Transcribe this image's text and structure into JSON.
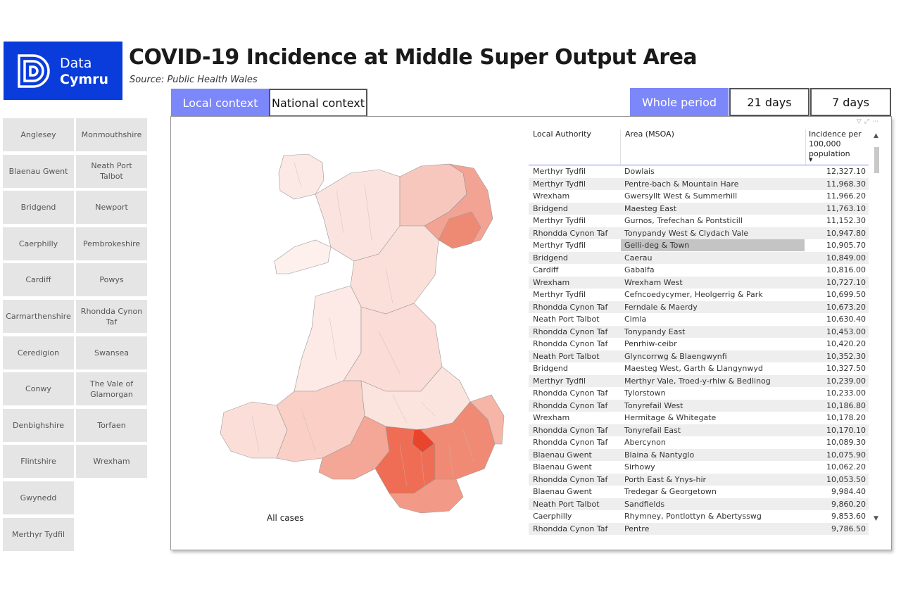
{
  "brand": {
    "line1": "Data",
    "line2": "Cymru",
    "color": "#0a3cdc"
  },
  "header": {
    "title": "COVID-19 Incidence at Middle Super Output Area",
    "source": "Source: Public Health Wales"
  },
  "context_tabs": [
    {
      "label": "Local context",
      "active": true
    },
    {
      "label": "National context",
      "active": false
    }
  ],
  "period_tabs": [
    {
      "label": "Whole period",
      "active": true
    },
    {
      "label": "21 days",
      "active": false
    },
    {
      "label": "7 days",
      "active": false
    }
  ],
  "accent_color": "#7c87f9",
  "authorities": [
    "Anglesey",
    "Monmouthshire",
    "Blaenau Gwent",
    "Neath Port Talbot",
    "Bridgend",
    "Newport",
    "Caerphilly",
    "Pembrokeshire",
    "Cardiff",
    "Powys",
    "Carmarthenshire",
    "Rhondda Cynon Taf",
    "Ceredigion",
    "Swansea",
    "Conwy",
    "The Vale of Glamorgan",
    "Denbighshire",
    "Torfaen",
    "Flintshire",
    "Wrexham",
    "Gwynedd",
    "Merthyr Tydfil"
  ],
  "map": {
    "caption": "All cases",
    "scale_low": "#fdf0ee",
    "scale_high": "#ef4a35"
  },
  "table": {
    "headers": {
      "authority": "Local Authority",
      "area": "Area (MSOA)",
      "incidence": "Incidence per 100,000 population"
    },
    "rows": [
      {
        "authority": "Merthyr Tydfil",
        "area": "Dowlais",
        "incidence": "12,327.10"
      },
      {
        "authority": "Merthyr Tydfil",
        "area": "Pentre-bach & Mountain Hare",
        "incidence": "11,968.30"
      },
      {
        "authority": "Wrexham",
        "area": "Gwersyllt West & Summerhill",
        "incidence": "11,966.20"
      },
      {
        "authority": "Bridgend",
        "area": "Maesteg East",
        "incidence": "11,763.10"
      },
      {
        "authority": "Merthyr Tydfil",
        "area": "Gurnos, Trefechan & Pontsticill",
        "incidence": "11,152.30"
      },
      {
        "authority": "Rhondda Cynon Taf",
        "area": "Tonypandy West & Clydach Vale",
        "incidence": "10,947.80"
      },
      {
        "authority": "Merthyr Tydfil",
        "area": "Gelli-deg & Town",
        "incidence": "10,905.70",
        "selected": true
      },
      {
        "authority": "Bridgend",
        "area": "Caerau",
        "incidence": "10,849.00"
      },
      {
        "authority": "Cardiff",
        "area": "Gabalfa",
        "incidence": "10,816.00"
      },
      {
        "authority": "Wrexham",
        "area": "Wrexham West",
        "incidence": "10,727.10"
      },
      {
        "authority": "Merthyr Tydfil",
        "area": "Cefncoedycymer, Heolgerrig & Park",
        "incidence": "10,699.50"
      },
      {
        "authority": "Rhondda Cynon Taf",
        "area": "Ferndale & Maerdy",
        "incidence": "10,673.20"
      },
      {
        "authority": "Neath Port Talbot",
        "area": "Cimla",
        "incidence": "10,630.40"
      },
      {
        "authority": "Rhondda Cynon Taf",
        "area": "Tonypandy East",
        "incidence": "10,453.00"
      },
      {
        "authority": "Rhondda Cynon Taf",
        "area": "Penrhiw-ceibr",
        "incidence": "10,420.20"
      },
      {
        "authority": "Neath Port Talbot",
        "area": "Glyncorrwg & Blaengwynfi",
        "incidence": "10,352.30"
      },
      {
        "authority": "Bridgend",
        "area": "Maesteg West, Garth & Llangynwyd",
        "incidence": "10,327.50"
      },
      {
        "authority": "Merthyr Tydfil",
        "area": "Merthyr Vale, Troed-y-rhiw & Bedlinog",
        "incidence": "10,239.00"
      },
      {
        "authority": "Rhondda Cynon Taf",
        "area": "Tylorstown",
        "incidence": "10,233.00"
      },
      {
        "authority": "Rhondda Cynon Taf",
        "area": "Tonyrefail West",
        "incidence": "10,186.80"
      },
      {
        "authority": "Wrexham",
        "area": "Hermitage & Whitegate",
        "incidence": "10,178.20"
      },
      {
        "authority": "Rhondda Cynon Taf",
        "area": "Tonyrefail East",
        "incidence": "10,170.10"
      },
      {
        "authority": "Rhondda Cynon Taf",
        "area": "Abercynon",
        "incidence": "10,089.30"
      },
      {
        "authority": "Blaenau Gwent",
        "area": "Blaina & Nantyglo",
        "incidence": "10,075.90"
      },
      {
        "authority": "Blaenau Gwent",
        "area": "Sirhowy",
        "incidence": "10,062.20"
      },
      {
        "authority": "Rhondda Cynon Taf",
        "area": "Porth East & Ynys-hir",
        "incidence": "10,053.50"
      },
      {
        "authority": "Blaenau Gwent",
        "area": "Tredegar & Georgetown",
        "incidence": "9,984.40"
      },
      {
        "authority": "Neath Port Talbot",
        "area": "Sandfields",
        "incidence": "9,860.20"
      },
      {
        "authority": "Caerphilly",
        "area": "Rhymney, Pontlottyn & Abertysswg",
        "incidence": "9,853.60"
      },
      {
        "authority": "Rhondda Cynon Taf",
        "area": "Pentre",
        "incidence": "9,786.50"
      }
    ]
  }
}
